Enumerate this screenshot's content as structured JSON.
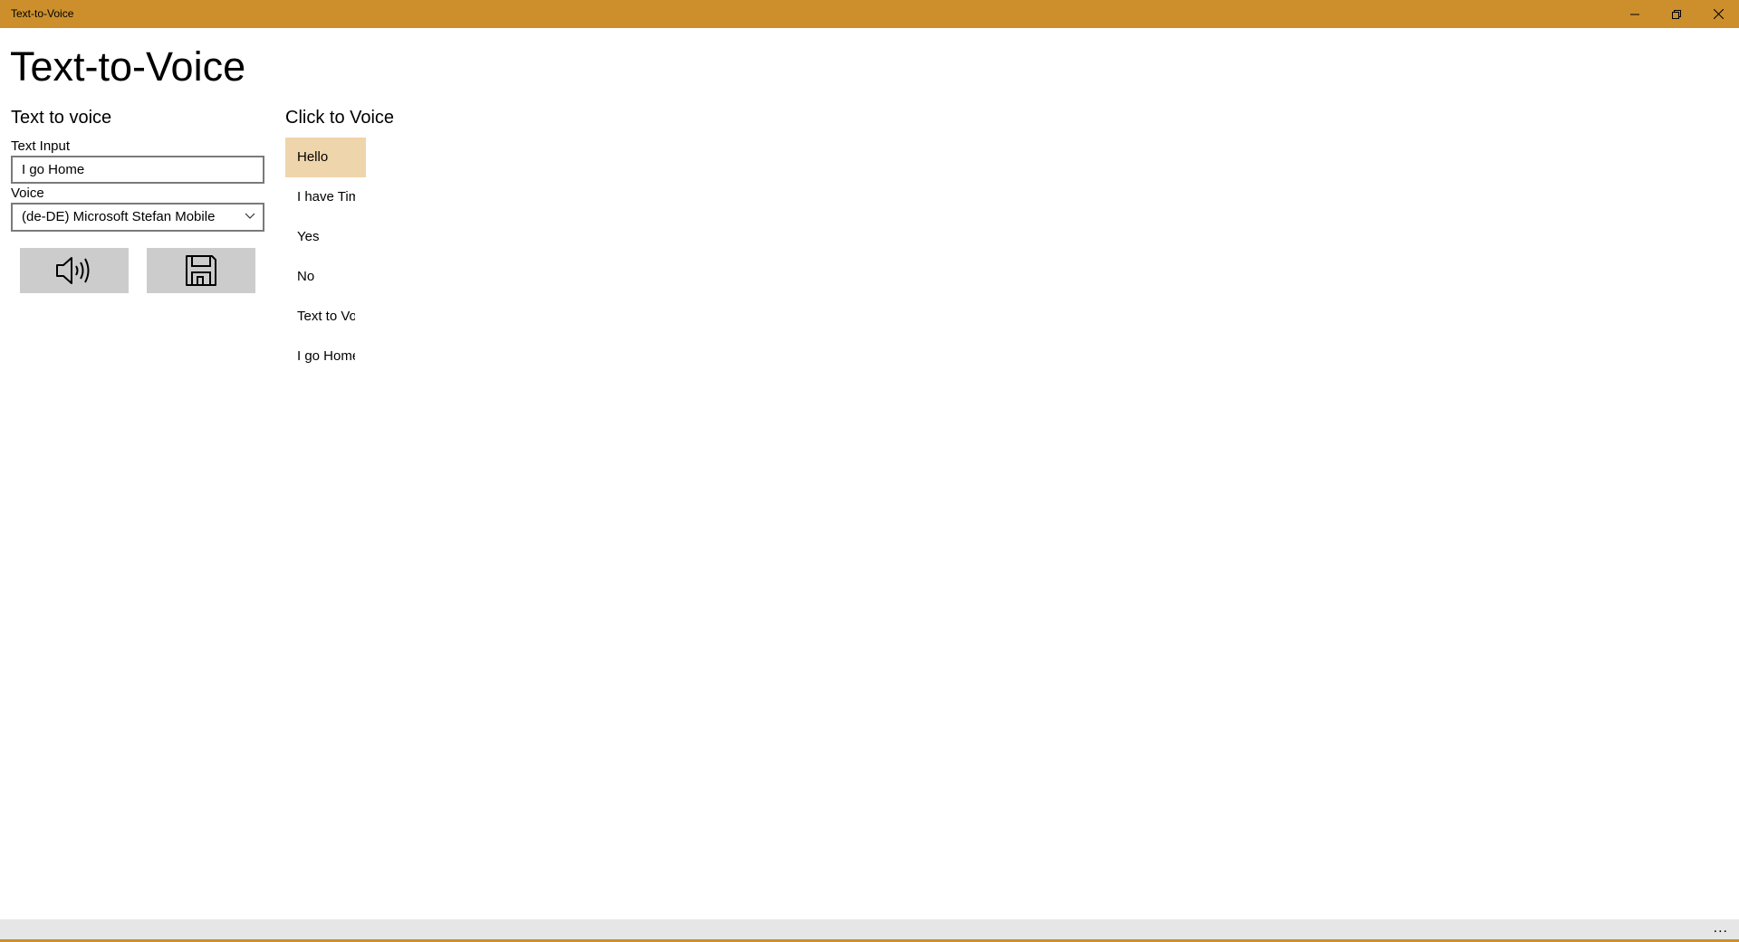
{
  "window": {
    "title": "Text-to-Voice",
    "accent_color": "#cc8f2c",
    "controls": [
      "minimize-icon",
      "restore-icon",
      "close-icon"
    ]
  },
  "page": {
    "title": "Text-to-Voice"
  },
  "left_section": {
    "heading": "Text to voice",
    "text_input_label": "Text Input",
    "text_input_value": "I go Home",
    "voice_label": "Voice",
    "voice_selected": "(de-DE) Microsoft Stefan Mobile",
    "buttons": [
      {
        "icon": "speaker-icon"
      },
      {
        "icon": "save-icon"
      }
    ]
  },
  "right_section": {
    "heading": "Click to Voice",
    "selected_color": "#efd5ab",
    "items": [
      {
        "label": "Hello",
        "selected": true
      },
      {
        "label": "I have Time",
        "selected": false
      },
      {
        "label": "Yes",
        "selected": false
      },
      {
        "label": "No",
        "selected": false
      },
      {
        "label": "Text to Voice",
        "selected": false
      },
      {
        "label": "I go Home",
        "selected": false
      }
    ]
  },
  "app_bar": {
    "more_label": "..."
  }
}
